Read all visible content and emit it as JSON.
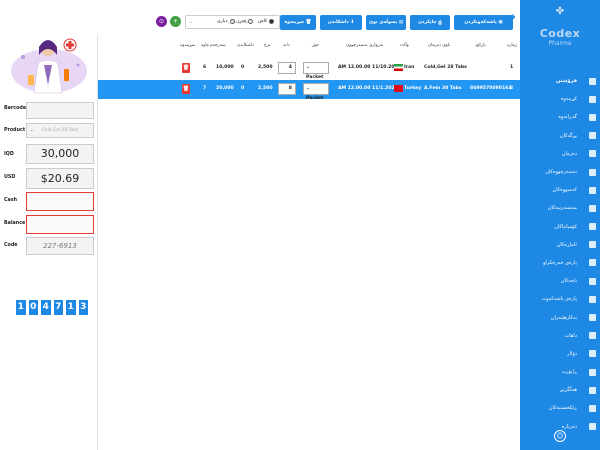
{
  "window": {
    "minimize": "–",
    "maximize": "□",
    "close": "×"
  },
  "sidebar": {
    "brand": "Codex",
    "brand_sub": "Pharma",
    "items": [
      {
        "label": "فرۆشتن"
      },
      {
        "label": "کڕینەوە"
      },
      {
        "label": "گەڕانەوە"
      },
      {
        "label": "بڕگەکان"
      },
      {
        "label": "دەرمان"
      },
      {
        "label": "بەسەرچووەکان"
      },
      {
        "label": "کەمبووەکان"
      },
      {
        "label": "مەشتەرییەکان"
      },
      {
        "label": "کۆمپانیاکان"
      },
      {
        "label": "ئاماڕەکان"
      },
      {
        "label": "پارەی خەرجکراو"
      },
      {
        "label": "باجەکان"
      },
      {
        "label": "پارەی پاشەکەوت"
      },
      {
        "label": "بەکارهێنەران"
      },
      {
        "label": "داهات"
      },
      {
        "label": "دۆلار"
      },
      {
        "label": "ڕاپۆرت"
      },
      {
        "label": "هەڵگرتن"
      },
      {
        "label": "ڕێکخستنەکان"
      },
      {
        "label": "دەربارە"
      }
    ]
  },
  "toolbar": {
    "btn1": "پاشەکەوتکردن",
    "btn2": "چاپکردن",
    "btn3": "پسوڵەی نوێ",
    "btn4": "داشکاندن",
    "btn5": "سڕینەوە",
    "radio_cash": "کاش",
    "radio_debt": "قەرز",
    "radio_box": "دیاری",
    "search_placeholder": "مەشتەرییەکان",
    "circle1": "+",
    "circle2": "⊙"
  },
  "table": {
    "headers": [
      "ژمارە",
      "بارکۆد",
      "ناوی دەرمان",
      "وڵات",
      "بەرواری بەسەرچوون",
      "جۆر",
      "دانە",
      "نرخ",
      "داشکاندن",
      "سەرجەم",
      "ماوە",
      "سڕینەوە"
    ],
    "rows": [
      {
        "no": "1",
        "barcode": "",
        "name": "Cold,Gel 28 Tabs",
        "country": "Iran",
        "expiry": "AM 12.00.00 11/10.2021",
        "unit": "Packet",
        "qty": "4",
        "price": "2,500",
        "discount": "0",
        "total": "10,000",
        "remain": "6"
      },
      {
        "no": "2",
        "barcode": "8699570090164",
        "name": "A.Fein 30 Tabs",
        "country": "Turkey",
        "expiry": "AM 12.00.00 11/1.2022",
        "unit": "Packet",
        "qty": "8",
        "price": "2,500",
        "discount": "0",
        "total": "20,000",
        "remain": "7"
      }
    ]
  },
  "panel": {
    "barcode_label": "Barcode",
    "product_label": "Product",
    "product_value": "Cold,Gel 28 Tabs",
    "iqd_label": "IQD",
    "iqd_value": "30,000",
    "usd_label": "USD",
    "usd_value": "$20.69",
    "cash_label": "Cash",
    "balance_label": "Balance",
    "code_label": "Code",
    "code_value": "227-6913",
    "time_digits": [
      "1",
      "0",
      "4",
      "7",
      "1",
      "3"
    ]
  },
  "colors": {
    "accent": "#1e88e5",
    "danger": "#e53935",
    "selected_row": "#2196f3"
  }
}
